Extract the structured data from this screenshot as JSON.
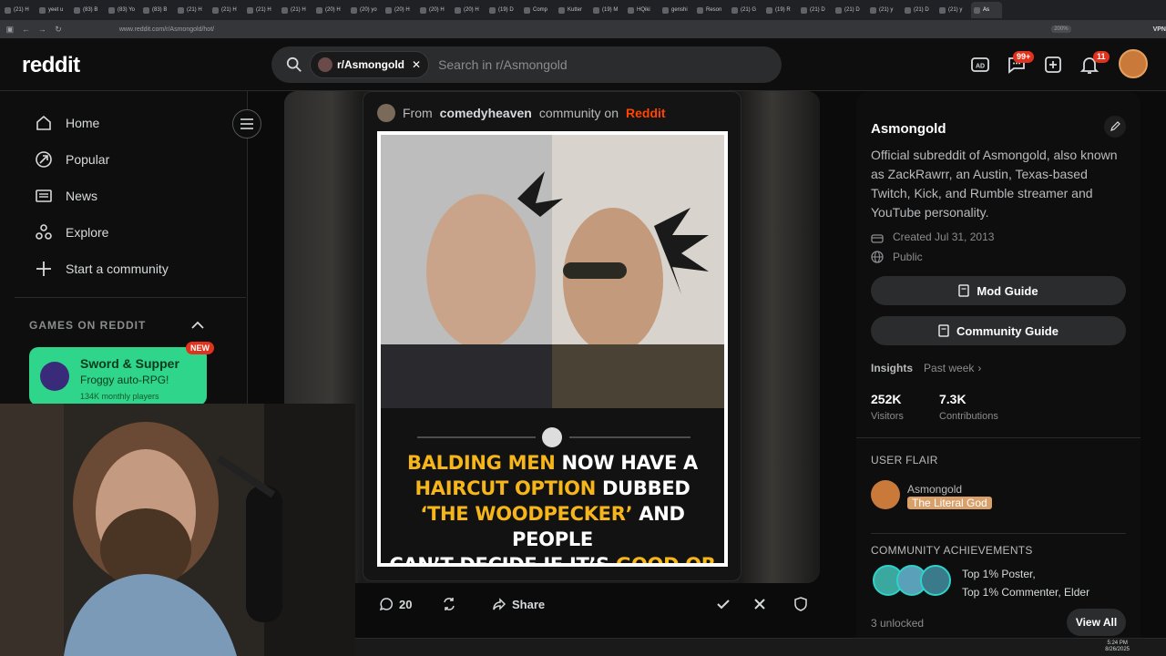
{
  "browser": {
    "tabs": [
      "(21) H",
      "yeet u",
      "(83) B",
      "(83) Yo",
      "(83) B",
      "(21) H",
      "(21) H",
      "(21) H",
      "(21) H",
      "(20) H",
      "(20) yo",
      "(20) H",
      "(20) H",
      "(20) H",
      "(19) D",
      "Comp",
      "Kutter",
      "(19) M",
      "HQiki",
      "genshi",
      "Reson",
      "(21) G",
      "(19) R",
      "(21) D",
      "(21) D",
      "(21) y",
      "(21) D",
      "(21) y",
      "As"
    ],
    "url": "www.reddit.com/r/Asmongold/hot/",
    "zoom": "200%",
    "vpn": "VPN"
  },
  "header": {
    "logo": "reddit",
    "search_chip": "r/Asmongold",
    "search_placeholder": "Search in r/Asmongold",
    "chat_badge": "99+",
    "notif_badge": "11"
  },
  "left_nav": {
    "items": [
      {
        "label": "Home",
        "icon": "home-icon"
      },
      {
        "label": "Popular",
        "icon": "popular-icon"
      },
      {
        "label": "News",
        "icon": "news-icon"
      },
      {
        "label": "Explore",
        "icon": "explore-icon"
      },
      {
        "label": "Start a community",
        "icon": "plus-icon"
      }
    ],
    "games_heading": "GAMES ON REDDIT",
    "game": {
      "title": "Sword & Supper",
      "subtitle": "Froggy auto-RPG!",
      "players": "134K monthly players",
      "badge": "NEW"
    }
  },
  "post": {
    "from_prefix": "From",
    "community": "comedyheaven",
    "middle": "community on",
    "platform": "Reddit",
    "headline": {
      "l1a": "BALDING MEN",
      "l1b": " NOW HAVE A",
      "l2a": "HAIRCUT OPTION",
      "l2b": " DUBBED",
      "l3a": "‘THE WOODPECKER’",
      "l3b": " AND PEOPLE",
      "l4a": "CAN’T DECIDE IF IT’S ",
      "l4b": "GOOD OR NOT"
    },
    "comment_count": "20",
    "share_label": "Share"
  },
  "right_sidebar": {
    "title": "Asmongold",
    "description": "Official subreddit of Asmongold, also known as ZackRawrr, an Austin, Texas-based Twitch, Kick, and Rumble streamer and YouTube personality.",
    "created": "Created Jul 31, 2013",
    "visibility": "Public",
    "mod_guide": "Mod Guide",
    "community_guide": "Community Guide",
    "insights_label": "Insights",
    "insights_period": "Past week",
    "visitors_value": "252K",
    "visitors_label": "Visitors",
    "contrib_value": "7.3K",
    "contrib_label": "Contributions",
    "user_flair_heading": "USER FLAIR",
    "flair_user": "Asmongold",
    "flair_tag": "The Literal God",
    "achievements_heading": "COMMUNITY ACHIEVEMENTS",
    "achievement_1": "Top 1% Poster,",
    "achievement_2": "Top 1% Commenter, Elder",
    "unlocked": "3 unlocked",
    "view_all": "View All"
  },
  "taskbar": {
    "time": "5:24 PM",
    "date": "8/26/2025"
  },
  "colors": {
    "accent": "#ff4500",
    "headline_yellow": "#f6b61a",
    "game_green": "#2fd58a",
    "flair": "#d9a06a"
  }
}
